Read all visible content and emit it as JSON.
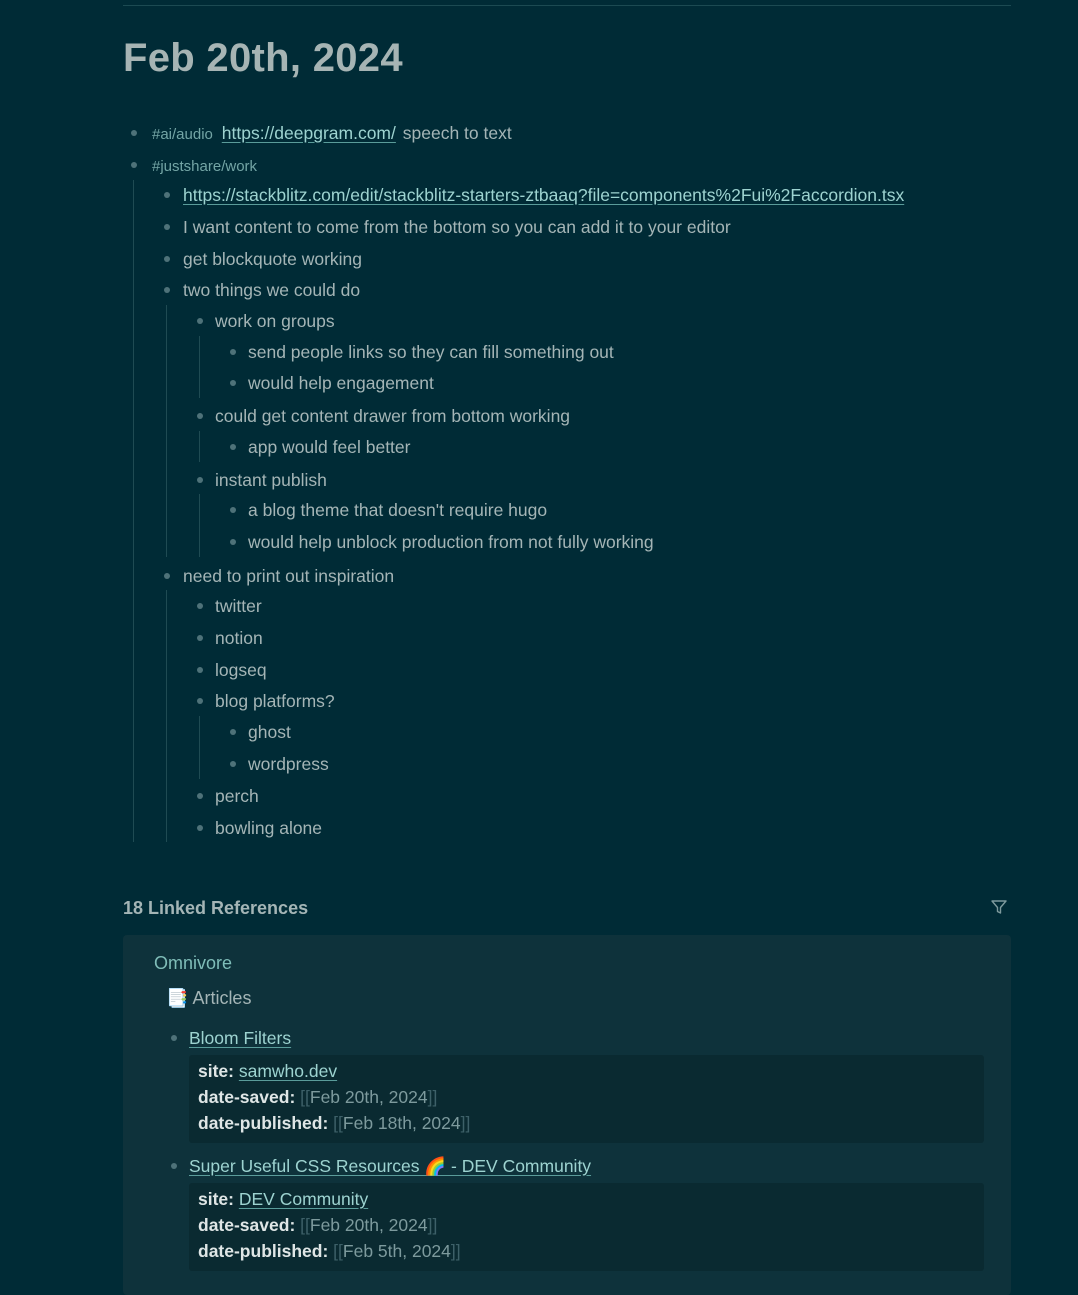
{
  "page": {
    "title": "Feb 20th, 2024"
  },
  "blocks": {
    "b1": {
      "tag": "#ai/audio",
      "link": "https://deepgram.com/",
      "text": "speech to text"
    },
    "b2": {
      "tag": "#justshare/work"
    },
    "b3": {
      "link": "https://stackblitz.com/edit/stackblitz-starters-ztbaaq?file=components%2Fui%2Faccordion.tsx"
    },
    "b4": "I want content to come from the bottom so you can add it to your editor",
    "b5": "get blockquote working",
    "b6": "two things we could do",
    "b7": "work on groups",
    "b8": "send people links so they can fill something out",
    "b9": "would help engagement",
    "b10": "could get content drawer from bottom working",
    "b11": "app would feel better",
    "b12": "instant publish",
    "b13": "a blog theme that doesn't require hugo",
    "b14": "would help unblock production from not fully working",
    "b15": "need to print out inspiration",
    "b16": "twitter",
    "b17": "notion",
    "b18": "logseq",
    "b19": "blog platforms?",
    "b20": "ghost",
    "b21": "wordpress",
    "b22": "perch",
    "b23": "bowling alone"
  },
  "references": {
    "header": "18 Linked References",
    "filter_icon": "filter-icon",
    "page": "Omnivore",
    "group": {
      "emoji": "📑",
      "label": "Articles"
    },
    "items": [
      {
        "title": "Bloom Filters",
        "site_key": "site",
        "site": "samwho.dev",
        "saved_key": "date-saved",
        "saved": "Feb 20th, 2024",
        "published_key": "date-published",
        "published": "Feb 18th, 2024"
      },
      {
        "title": "Super Useful CSS Resources 🌈 - DEV Community",
        "site_key": "site",
        "site": "DEV Community",
        "saved_key": "date-saved",
        "saved": "Feb 20th, 2024",
        "published_key": "date-published",
        "published": "Feb 5th, 2024"
      }
    ]
  },
  "colors": {
    "background": "#002b36",
    "text": "#a4b5b6",
    "link": "#9dd3d0",
    "tag": "#73a5a5",
    "panel": "#0e323b"
  }
}
